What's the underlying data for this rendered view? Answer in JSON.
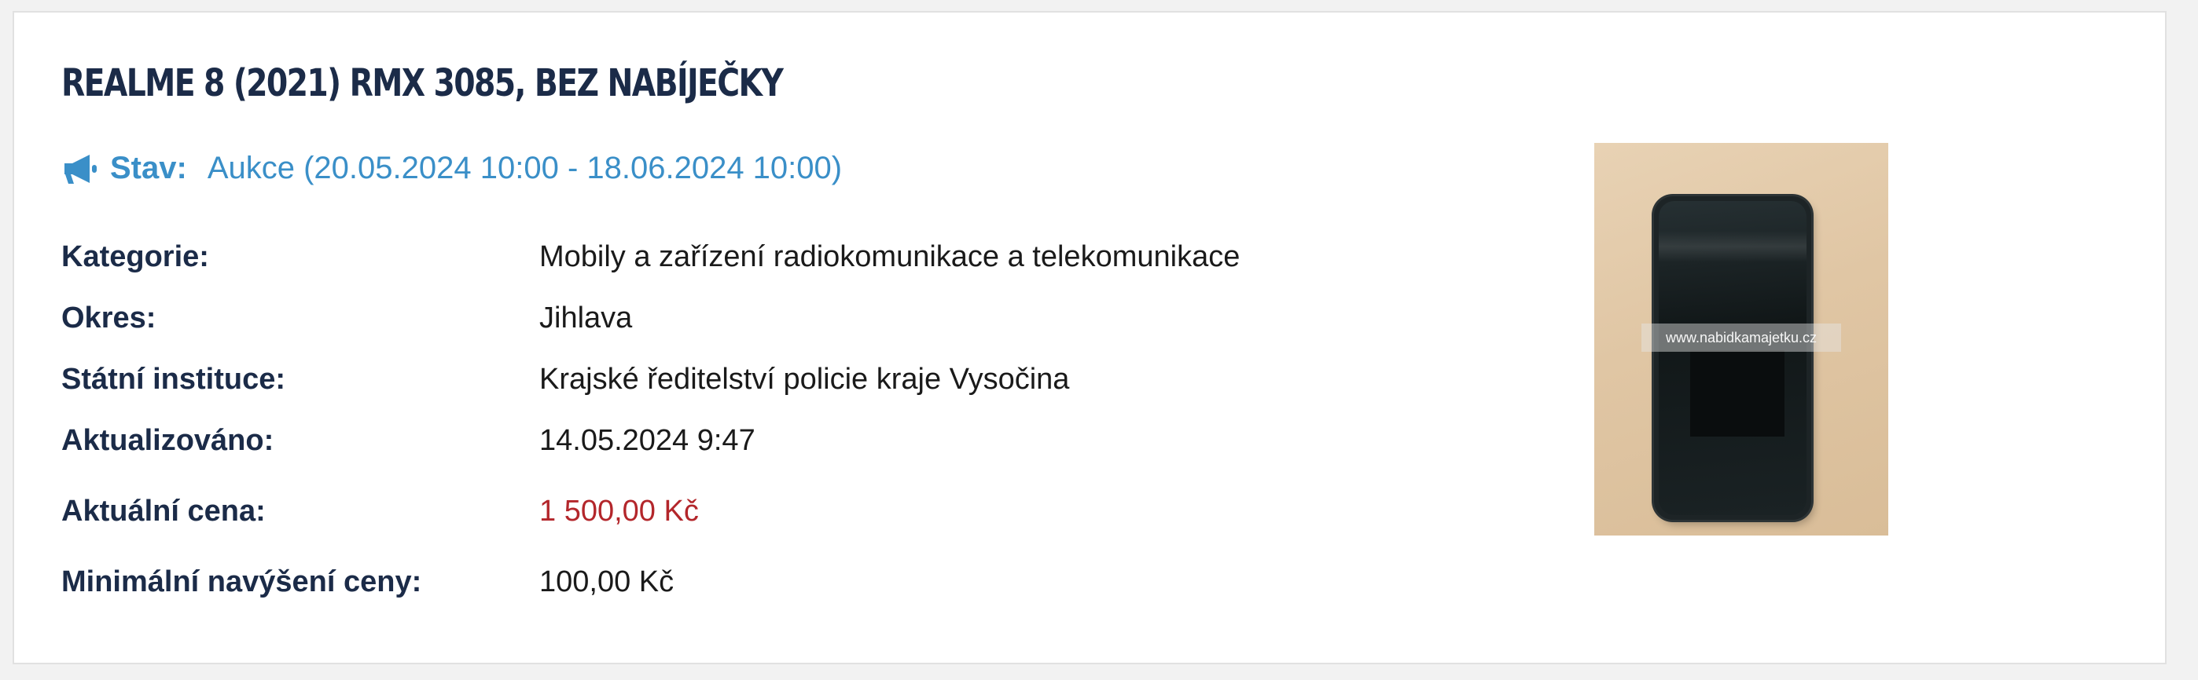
{
  "item": {
    "title": "REALME 8 (2021) RMX 3085, BEZ NABÍJEČKY"
  },
  "status": {
    "icon": "megaphone-icon",
    "label": "Stav:",
    "value": "Aukce (20.05.2024 10:00 - 18.06.2024 10:00)",
    "color": "#3a8fc8"
  },
  "details": [
    {
      "key": "Kategorie:",
      "value": "Mobily a zařízení radiokomunikace a telekomunikace"
    },
    {
      "key": "Okres:",
      "value": "Jihlava"
    },
    {
      "key": "Státní instituce:",
      "value": "Krajské ředitelství policie kraje Vysočina"
    },
    {
      "key": "Aktualizováno:",
      "value": "14.05.2024 9:47"
    },
    {
      "key": "Aktuální cena:",
      "value": "1 500,00 Kč"
    },
    {
      "key": "Minimální navýšení ceny:",
      "value": "100,00 Kč"
    }
  ],
  "price_color": "#b3262b",
  "photo": {
    "watermark": "www.nabidkamajetku.cz"
  }
}
